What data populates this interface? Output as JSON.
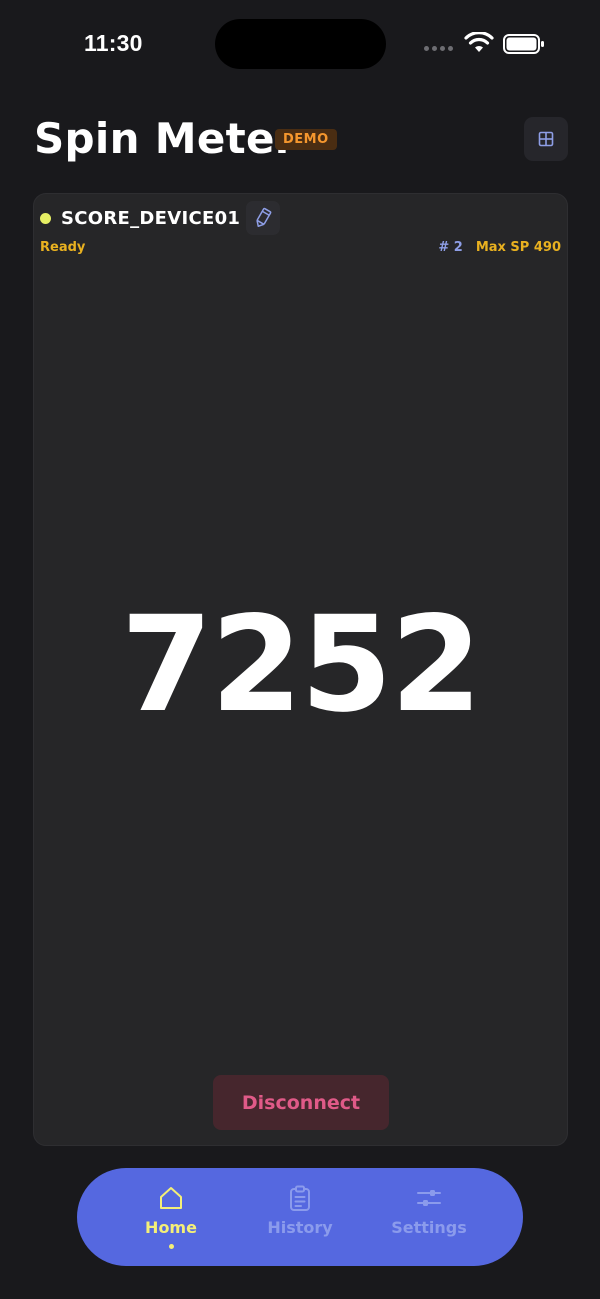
{
  "status_bar": {
    "time": "11:30"
  },
  "header": {
    "title": "Spin Meter",
    "badge": "DEMO",
    "layout_icon": "grid-icon"
  },
  "device": {
    "name": "SCORE_DEVICE01",
    "status": "Ready",
    "status_color": "#e6ef64",
    "rank": "# 2",
    "max_sp": "Max SP 490",
    "edit_icon": "pencil-icon"
  },
  "score": {
    "value": "7252"
  },
  "actions": {
    "disconnect_label": "Disconnect"
  },
  "tabs": [
    {
      "label": "Home",
      "icon": "home-icon",
      "active": true
    },
    {
      "label": "History",
      "icon": "clipboard-icon",
      "active": false
    },
    {
      "label": "Settings",
      "icon": "sliders-icon",
      "active": false
    }
  ],
  "colors": {
    "accent": "#5568e0",
    "active_tab": "#f4ef78",
    "badge_text": "#f5972e",
    "warning_text": "#e9b120",
    "danger_text": "#e05a88"
  }
}
